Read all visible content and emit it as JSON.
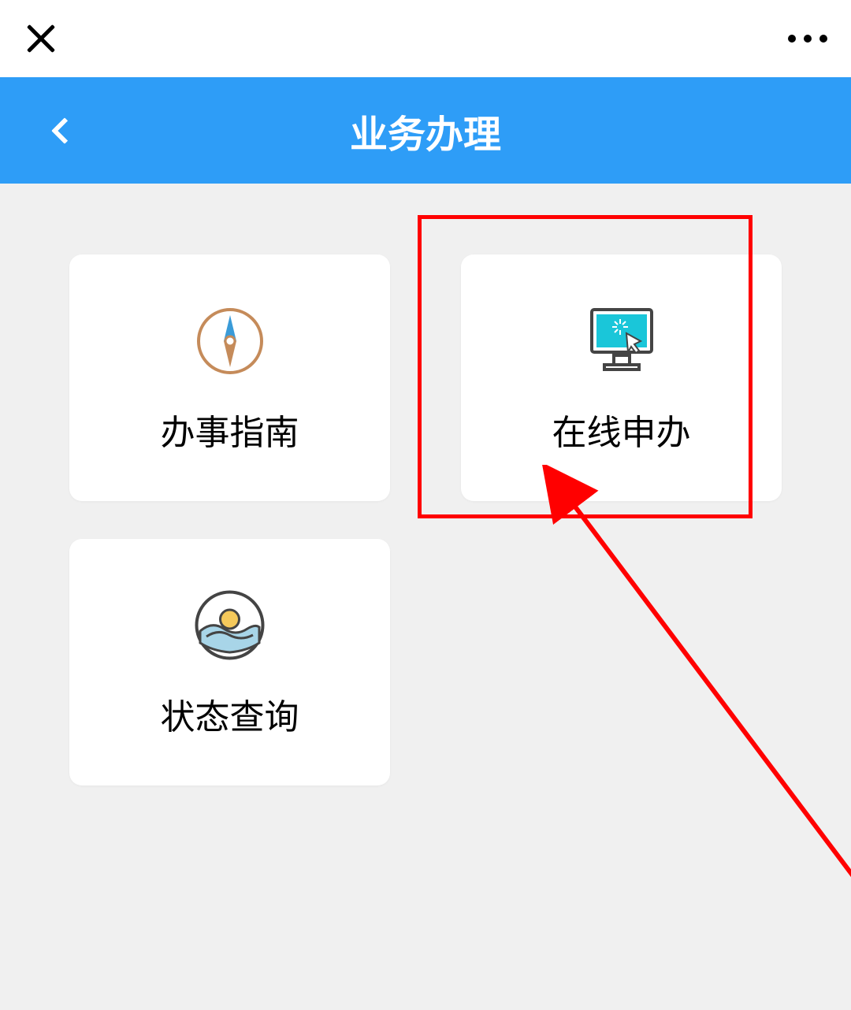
{
  "header": {
    "title": "业务办理"
  },
  "cards": [
    {
      "label": "办事指南",
      "icon": "compass-icon"
    },
    {
      "label": "在线申办",
      "icon": "monitor-click-icon"
    },
    {
      "label": "状态查询",
      "icon": "sunrise-water-icon"
    }
  ],
  "annotation": {
    "highlight_target": "在线申办",
    "highlight_color": "#ff0000"
  }
}
